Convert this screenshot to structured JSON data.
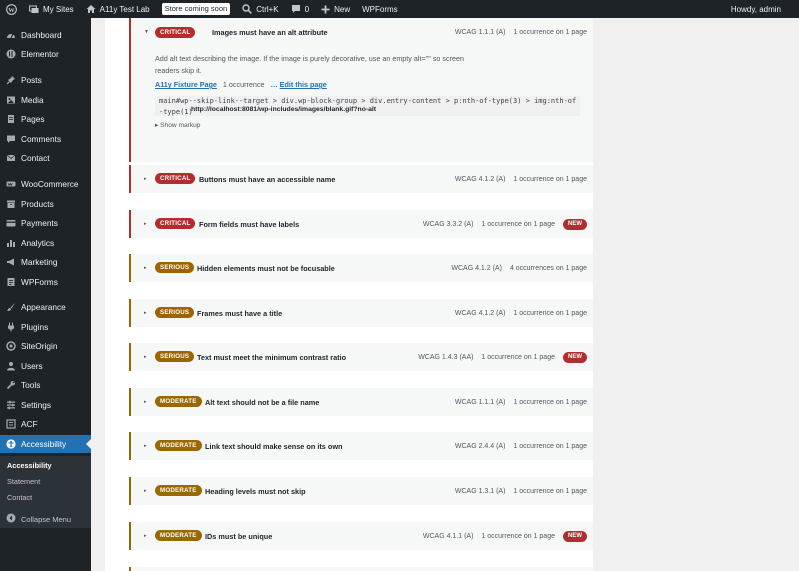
{
  "adminbar": {
    "my_sites": "My Sites",
    "site_name": "A11y Test Lab",
    "store_badge": "Store coming soon",
    "shortcut": "Ctrl+K",
    "comments_count": "0",
    "new_label": "New",
    "wpforms": "WPForms",
    "howdy": "Howdy, admin"
  },
  "sidebar": {
    "items": [
      {
        "label": "Dashboard",
        "icon": "dashboard-icon"
      },
      {
        "label": "Elementor",
        "icon": "elementor-icon"
      },
      {
        "label": "Posts",
        "icon": "pin-icon"
      },
      {
        "label": "Media",
        "icon": "media-icon"
      },
      {
        "label": "Pages",
        "icon": "page-icon"
      },
      {
        "label": "Comments",
        "icon": "comment-icon"
      },
      {
        "label": "Contact",
        "icon": "mail-icon"
      },
      {
        "label": "WooCommerce",
        "icon": "woo-icon"
      },
      {
        "label": "Products",
        "icon": "archive-icon"
      },
      {
        "label": "Payments",
        "icon": "card-icon"
      },
      {
        "label": "Analytics",
        "icon": "chart-icon"
      },
      {
        "label": "Marketing",
        "icon": "megaphone-icon"
      },
      {
        "label": "WPForms",
        "icon": "form-icon"
      },
      {
        "label": "Appearance",
        "icon": "brush-icon"
      },
      {
        "label": "Plugins",
        "icon": "plugin-icon"
      },
      {
        "label": "SiteOrigin",
        "icon": "siteorigin-icon"
      },
      {
        "label": "Users",
        "icon": "user-icon"
      },
      {
        "label": "Tools",
        "icon": "wrench-icon"
      },
      {
        "label": "Settings",
        "icon": "settings-icon"
      },
      {
        "label": "ACF",
        "icon": "acf-icon"
      },
      {
        "label": "Accessibility",
        "icon": "accessibility-icon"
      }
    ],
    "submenu": [
      "Accessibility",
      "Statement",
      "Contact"
    ],
    "collapse": "Collapse Menu"
  },
  "colors": {
    "critical": "#b32d2e",
    "serious": "#9d6400",
    "moderate": "#996800",
    "accent": "#2271b1"
  },
  "expanded_issue": {
    "severity": "CRITICAL",
    "title": "Images must have an alt attribute",
    "wcag": "WCAG 1.1.1 (A)",
    "count": "1 occurrence on 1 page",
    "description": "Add alt text describing the image. If the image is purely decorative, use an empty alt=\"\" so screen readers skip it.",
    "page_link": "A11y Fixture Page",
    "occurrences": "1 occurrence",
    "edit_link": "Edit this page",
    "selector": "main#wp--skip-link--target > div.wp-block-group > div.entry-content > p:nth-of-type(3) > img:nth-of-type(1)",
    "url": "http://localhost:8081/wp-includes/images/blank.gif?no-alt",
    "show_markup": "Show markup"
  },
  "issues": [
    {
      "severity": "CRITICAL",
      "title": "Buttons must have an accessible name",
      "wcag": "WCAG 4.1.2 (A)",
      "count": "1 occurrence on 1 page",
      "new": ""
    },
    {
      "severity": "CRITICAL",
      "title": "Form fields must have labels",
      "wcag": "WCAG 3.3.2 (A)",
      "count": "1 occurrence on 1 page",
      "new": "NEW"
    },
    {
      "severity": "SERIOUS",
      "title": "Hidden elements must not be focusable",
      "wcag": "WCAG 4.1.2 (A)",
      "count": "4 occurrences on 1 page",
      "new": ""
    },
    {
      "severity": "SERIOUS",
      "title": "Frames must have a title",
      "wcag": "WCAG 4.1.2 (A)",
      "count": "1 occurrence on 1 page",
      "new": ""
    },
    {
      "severity": "SERIOUS",
      "title": "Text must meet the minimum contrast ratio",
      "wcag": "WCAG 1.4.3 (AA)",
      "count": "1 occurrence on 1 page",
      "new": "NEW"
    },
    {
      "severity": "MODERATE",
      "title": "Alt text should not be a file name",
      "wcag": "WCAG 1.1.1 (A)",
      "count": "1 occurrence on 1 page",
      "new": ""
    },
    {
      "severity": "MODERATE",
      "title": "Link text should make sense on its own",
      "wcag": "WCAG 2.4.4 (A)",
      "count": "1 occurrence on 1 page",
      "new": ""
    },
    {
      "severity": "MODERATE",
      "title": "Heading levels must not skip",
      "wcag": "WCAG 1.3.1 (A)",
      "count": "1 occurrence on 1 page",
      "new": ""
    },
    {
      "severity": "MODERATE",
      "title": "IDs must be unique",
      "wcag": "WCAG 4.1.1 (A)",
      "count": "1 occurrence on 1 page",
      "new": "NEW"
    }
  ]
}
